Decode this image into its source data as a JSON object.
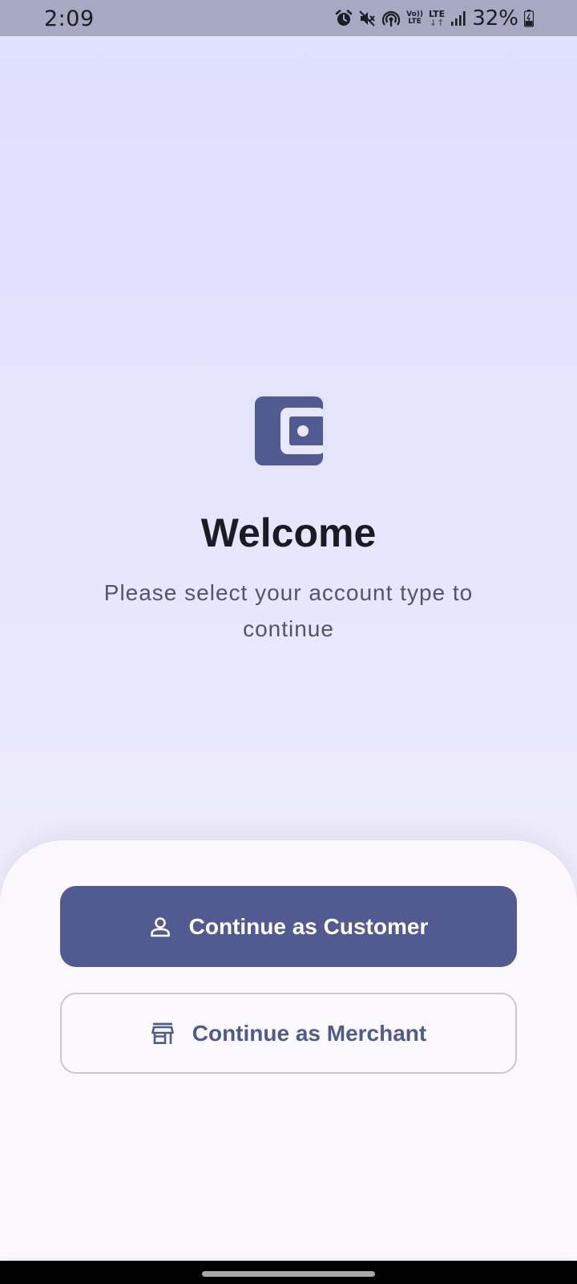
{
  "status_bar": {
    "time": "2:09",
    "icons": [
      "alarm-icon",
      "mute-icon",
      "hotspot-icon",
      "volte-icon",
      "lte-data-icon",
      "signal-icon",
      "battery-icon"
    ],
    "volte_label_top": "Vo))",
    "volte_label_bottom": "LTE",
    "lte_label": "LTE",
    "battery_percent": "32%"
  },
  "logo": {
    "icon": "wallet-icon",
    "color": "#525b91"
  },
  "welcome": {
    "title": "Welcome",
    "subtitle": "Please select your account type to continue"
  },
  "actions": {
    "customer_label": "Continue as Customer",
    "customer_icon": "person-icon",
    "merchant_label": "Continue as Merchant",
    "merchant_icon": "store-icon"
  },
  "colors": {
    "primary": "#525b91",
    "background_top": "#dfdfff",
    "sheet": "#faf7fd",
    "title_text": "#1b1b22",
    "subtitle_text": "#56555f"
  }
}
